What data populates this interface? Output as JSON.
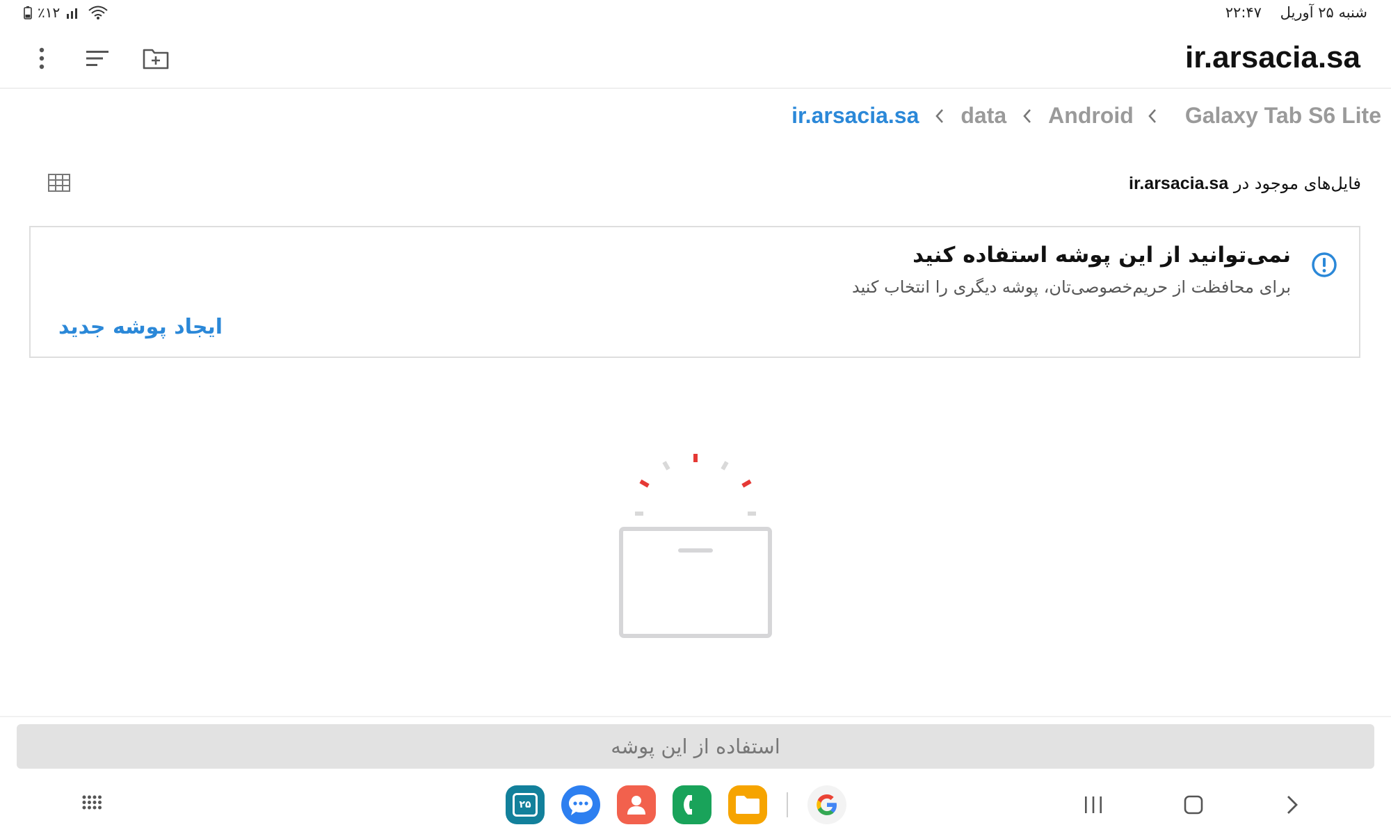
{
  "status_bar": {
    "battery_text": "٪۱۲",
    "date": "شنبه ۲۵ آوریل",
    "time": "۲۲:۴۷"
  },
  "app_bar": {
    "title": "ir.arsacia.sa",
    "icons": [
      "more-vert-icon",
      "sort-icon",
      "new-folder-icon"
    ]
  },
  "breadcrumb": [
    {
      "label": "Galaxy Tab S6 Lite",
      "active": false
    },
    {
      "label": "Android",
      "active": false
    },
    {
      "label": "data",
      "active": false
    },
    {
      "label": "ir.arsacia.sa",
      "active": true
    }
  ],
  "subheader": {
    "prefix": "فایل‌های موجود در",
    "folder": "ir.arsacia.sa"
  },
  "warning": {
    "title": "نمی‌توانید از این پوشه استفاده کنید",
    "subtitle": "برای محافظت از حریم‌خصوصی‌تان، پوشه دیگری را انتخاب کنید",
    "action": "ایجاد پوشه جدید"
  },
  "bottom": {
    "use_button": "استفاده از این پوشه"
  },
  "taskbar": {
    "calendar_day": "۲۵",
    "apps": [
      "calendar-app-icon",
      "messages-app-icon",
      "contacts-app-icon",
      "phone-app-icon",
      "my-files-app-icon",
      "google-app-icon"
    ]
  },
  "colors": {
    "accent": "#2b88d8",
    "muted_text": "#9a9a9a",
    "button_bg": "#e2e2e2",
    "illustration_red": "#e53935"
  }
}
